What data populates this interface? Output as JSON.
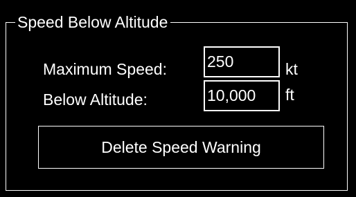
{
  "group": {
    "title": "Speed Below Altitude"
  },
  "max_speed": {
    "label": "Maximum Speed:",
    "value": "250",
    "unit": "kt"
  },
  "below_altitude": {
    "label": "Below Altitude:",
    "value": "10,000",
    "unit": "ft"
  },
  "delete_button": {
    "label": "Delete Speed Warning"
  },
  "colors": {
    "background": "#000000",
    "foreground": "#ffffff"
  }
}
